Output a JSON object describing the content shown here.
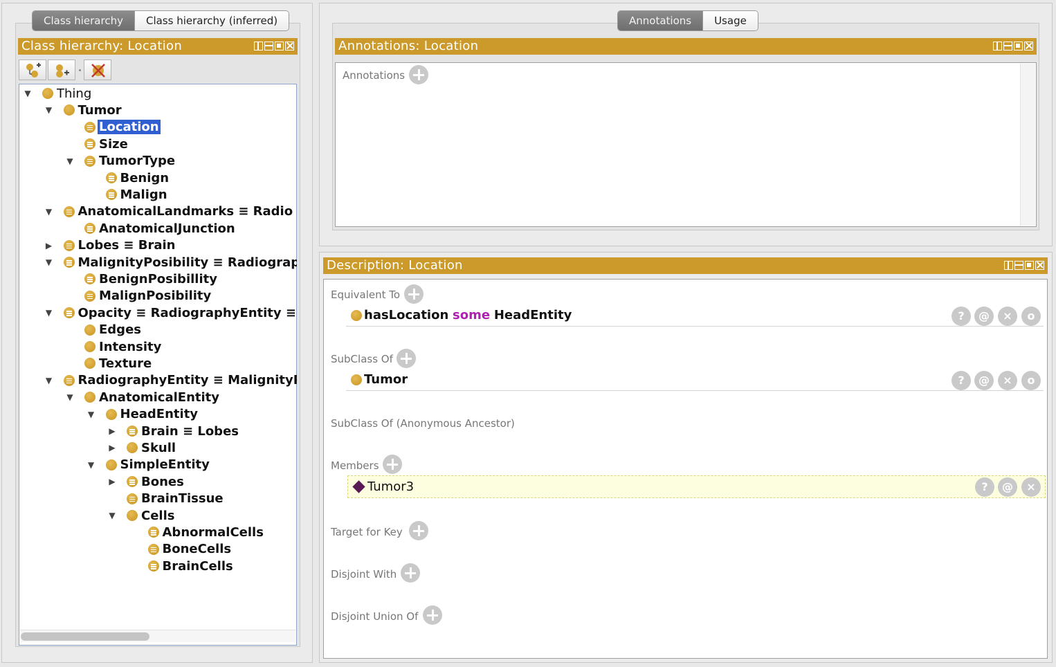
{
  "left": {
    "tabs": [
      {
        "label": "Class hierarchy",
        "active": true
      },
      {
        "label": "Class hierarchy (inferred)",
        "active": false
      }
    ],
    "view_title": "Class hierarchy: Location",
    "toolbar": [
      "add-subclass",
      "add-sibling",
      "delete-class"
    ],
    "tree": [
      {
        "label": "Thing",
        "bold": false,
        "defined": false,
        "expand": "open"
      },
      {
        "label": "Tumor",
        "bold": true,
        "defined": false,
        "expand": "open"
      },
      {
        "label": "Location",
        "bold": true,
        "defined": true,
        "expand": "none",
        "selected": true
      },
      {
        "label": "Size",
        "bold": true,
        "defined": true,
        "expand": "none"
      },
      {
        "label": "TumorType",
        "bold": true,
        "defined": true,
        "expand": "open"
      },
      {
        "label": "Benign",
        "bold": true,
        "defined": true,
        "expand": "none"
      },
      {
        "label": "Malign",
        "bold": true,
        "defined": true,
        "expand": "none"
      },
      {
        "label": "AnatomicalLandmarks ≡ Radio",
        "bold": true,
        "defined": true,
        "expand": "open"
      },
      {
        "label": "AnatomicalJunction",
        "bold": true,
        "defined": true,
        "expand": "none"
      },
      {
        "label": "Lobes ≡ Brain",
        "bold": true,
        "defined": true,
        "expand": "closed"
      },
      {
        "label": "MalignityPosibility ≡ Radiograp",
        "bold": true,
        "defined": true,
        "expand": "open"
      },
      {
        "label": "BenignPosibillity",
        "bold": true,
        "defined": true,
        "expand": "none"
      },
      {
        "label": "MalignPosibility",
        "bold": true,
        "defined": true,
        "expand": "none"
      },
      {
        "label": "Opacity ≡ RadiographyEntity ≡",
        "bold": true,
        "defined": true,
        "expand": "open"
      },
      {
        "label": "Edges",
        "bold": true,
        "defined": false,
        "expand": "none"
      },
      {
        "label": "Intensity",
        "bold": true,
        "defined": false,
        "expand": "none"
      },
      {
        "label": "Texture",
        "bold": true,
        "defined": false,
        "expand": "none"
      },
      {
        "label": "RadiographyEntity ≡ MalignityP",
        "bold": true,
        "defined": true,
        "expand": "open"
      },
      {
        "label": "AnatomicalEntity",
        "bold": true,
        "defined": false,
        "expand": "open"
      },
      {
        "label": "HeadEntity",
        "bold": true,
        "defined": false,
        "expand": "open"
      },
      {
        "label": "Brain ≡ Lobes",
        "bold": true,
        "defined": true,
        "expand": "closed"
      },
      {
        "label": "Skull",
        "bold": true,
        "defined": false,
        "expand": "closed"
      },
      {
        "label": "SimpleEntity",
        "bold": true,
        "defined": false,
        "expand": "open"
      },
      {
        "label": "Bones",
        "bold": true,
        "defined": true,
        "expand": "closed"
      },
      {
        "label": "BrainTissue",
        "bold": true,
        "defined": true,
        "expand": "none"
      },
      {
        "label": "Cells",
        "bold": true,
        "defined": false,
        "expand": "open"
      },
      {
        "label": "AbnormalCells",
        "bold": true,
        "defined": true,
        "expand": "none"
      },
      {
        "label": "BoneCells",
        "bold": true,
        "defined": true,
        "expand": "none"
      },
      {
        "label": "BrainCells",
        "bold": true,
        "defined": true,
        "expand": "none"
      }
    ]
  },
  "right": {
    "tabs": [
      {
        "label": "Annotations",
        "active": true
      },
      {
        "label": "Usage",
        "active": false
      }
    ],
    "annotations_title": "Annotations: Location",
    "annotations_label": "Annotations",
    "description_title": "Description: Location",
    "sections": {
      "equivalent_to": "Equivalent To",
      "subclass_of": "SubClass Of",
      "anon_ancestor": "SubClass Of (Anonymous Ancestor)",
      "members": "Members",
      "target_for_key": "Target for Key",
      "disjoint_with": "Disjoint With",
      "disjoint_union_of": "Disjoint Union Of"
    },
    "equivalent_row": {
      "prop": "hasLocation",
      "keyword": "some",
      "filler": "HeadEntity"
    },
    "subclass_row": {
      "label": "Tumor"
    },
    "member_row": {
      "label": "Tumor3"
    },
    "row_buttons": {
      "explain": "?",
      "annotate": "@",
      "delete": "×",
      "edit": "o"
    }
  },
  "colors": {
    "view_header": "#cc9a2a",
    "selection": "#2f5fd0",
    "class_icon": "#d4a535",
    "individual_icon": "#5a1a56",
    "keyword": "#b020b0"
  }
}
